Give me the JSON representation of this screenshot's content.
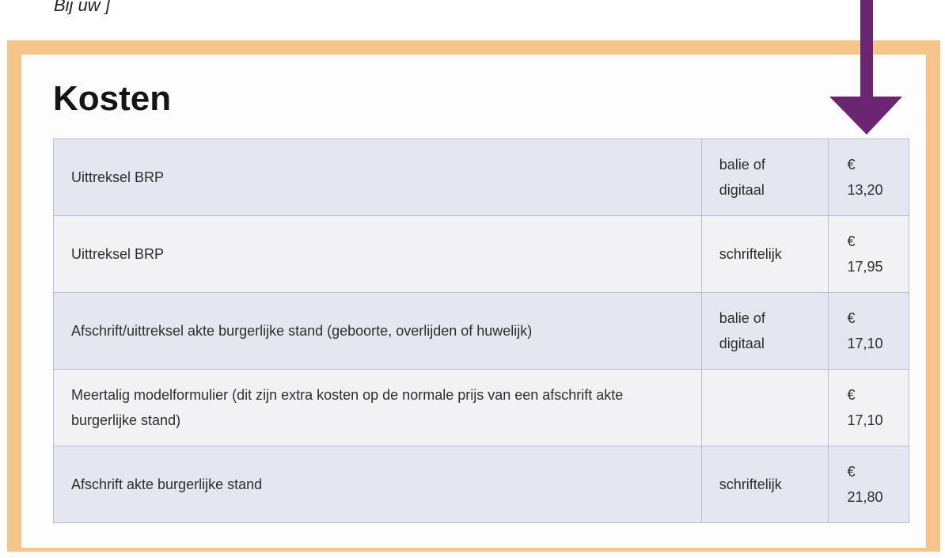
{
  "colors": {
    "frame": "#f5c58c",
    "panel": "#fdfdfe",
    "row_odd": "#e4e7ef",
    "row_even": "#f2f2f4",
    "border": "#b8bcd4",
    "arrow": "#6b2572"
  },
  "top_text": "Bij uw ]",
  "heading": "Kosten",
  "arrow_icon": "arrow-down-icon",
  "rows": [
    {
      "description": "Uittreksel BRP",
      "method": "balie of digitaal",
      "currency": "€",
      "amount": "13,20"
    },
    {
      "description": "Uittreksel BRP",
      "method": "schriftelijk",
      "currency": "€",
      "amount": "17,95"
    },
    {
      "description": "Afschrift/uittreksel akte burgerlijke stand (geboorte, overlijden of huwelijk)",
      "method": "balie of digitaal",
      "currency": "€",
      "amount": "17,10"
    },
    {
      "description": "Meertalig modelformulier (dit zijn extra kosten op de normale prijs van een afschrift akte burgerlijke stand)",
      "method": "",
      "currency": "€",
      "amount": "17,10"
    },
    {
      "description": "Afschrift akte burgerlijke stand",
      "method": "schriftelijk",
      "currency": "€",
      "amount": "21,80"
    }
  ]
}
